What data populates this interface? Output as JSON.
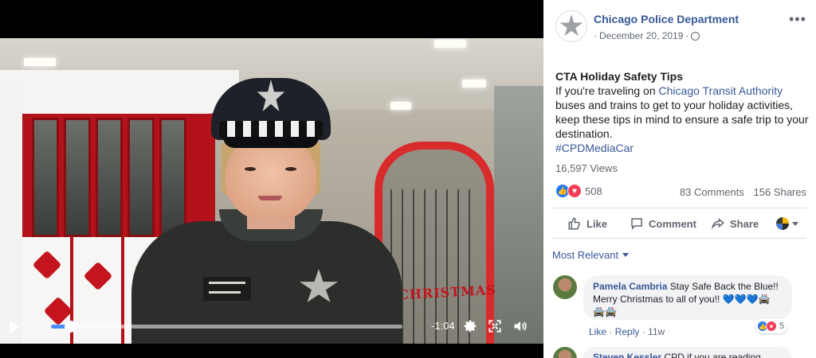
{
  "video": {
    "time_remaining": "-1:04",
    "progress": 0.055,
    "scene_text": "CHRISTMAS"
  },
  "post": {
    "page_name": "Chicago Police Department",
    "date": "December 20, 2019",
    "separator": "·",
    "title": "CTA Holiday Safety Tips",
    "body_before_link": "If you're traveling on ",
    "body_link": "Chicago Transit Authority",
    "body_after_link": " buses and trains to get to your holiday activities, keep these tips in mind to ensure a safe trip to your destination.",
    "hashtag": "#CPDMediaCar",
    "views": "16,597 Views",
    "reaction_count": "508",
    "comments_count": "83 Comments",
    "shares_count": "156 Shares"
  },
  "actions": {
    "like": "Like",
    "comment": "Comment",
    "share": "Share"
  },
  "comments_filter": "Most Relevant",
  "comments": [
    {
      "author": "Pamela Cambria",
      "text": "Stay Safe Back the Blue!! Merry Christmas to all of you!!",
      "emoji": "💙💙💙🚔 🚔🚔",
      "like_label": "Like",
      "reply_label": "Reply",
      "age": "11w",
      "reaction_count": "5"
    },
    {
      "author": "Steven Kessler",
      "text": "CPD if you are reading"
    }
  ],
  "colors": {
    "link": "#385898",
    "like_blue": "#2078f4",
    "love_red": "#f33e58",
    "progress_blue": "#4a8cff"
  }
}
